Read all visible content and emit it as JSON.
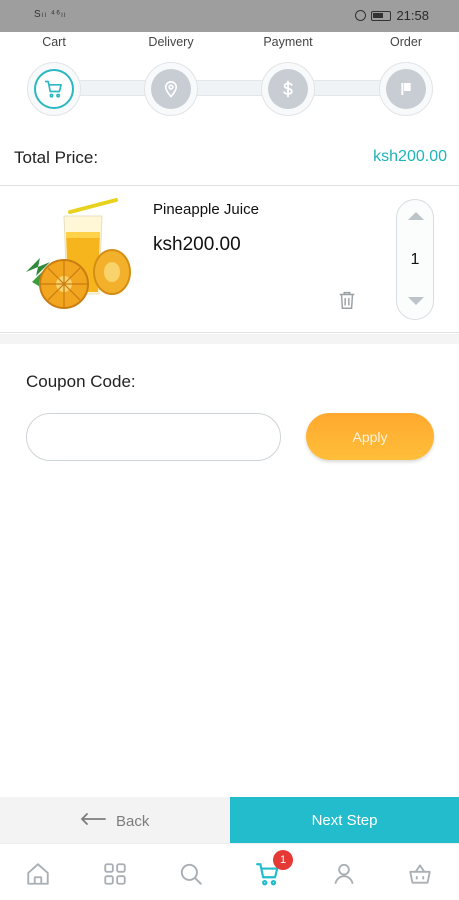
{
  "status_bar": {
    "signal": "Sₗₗ ⁴⁶ₗₗ",
    "time": "21:58"
  },
  "steps": [
    {
      "label": "Cart",
      "icon": "cart-icon",
      "active": true
    },
    {
      "label": "Delivery",
      "icon": "location-pin-icon",
      "active": false
    },
    {
      "label": "Payment",
      "icon": "dollar-icon",
      "active": false
    },
    {
      "label": "Order",
      "icon": "order-flag-icon",
      "active": false
    }
  ],
  "total": {
    "label": "Total Price:",
    "value": "ksh200.00"
  },
  "cart_item": {
    "name": "Pineapple Juice",
    "price": "ksh200.00",
    "quantity": "1",
    "image_icon": "pineapple-juice-image",
    "delete_icon": "trash-icon"
  },
  "coupon": {
    "label": "Coupon Code:",
    "value": "",
    "placeholder": "",
    "apply_label": "Apply"
  },
  "footer": {
    "back_label": "Back",
    "next_label": "Next Step"
  },
  "tabbar": {
    "items": [
      "home-icon",
      "categories-grid-icon",
      "search-icon",
      "cart-icon",
      "profile-icon",
      "basket-icon"
    ],
    "active_index": 3,
    "cart_badge": "1"
  },
  "colors": {
    "accent_teal": "#22bccc",
    "price_teal": "#1fb3ba",
    "apply_orange": "#ffa92e",
    "badge_red": "#e53935",
    "status_bar": "#9e9e9e"
  }
}
